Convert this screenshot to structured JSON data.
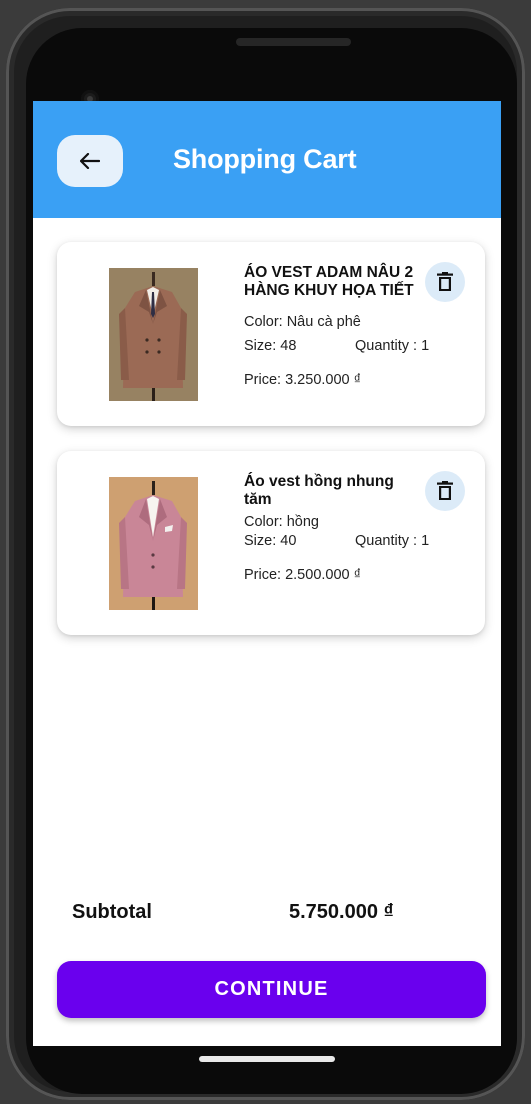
{
  "header": {
    "title": "Shopping Cart",
    "back_icon": "arrow-left-icon"
  },
  "items": [
    {
      "name": "ÁO VEST ADAM NÂU 2 HÀNG KHUY HỌA TIẾT",
      "color_text": "Color: Nâu cà phê",
      "size_text": "Size: 48",
      "quantity_text": "Quantity : 1",
      "price_text": "Price: 3.250.000 ₫",
      "delete_icon": "trash-icon",
      "jacket_color": "#9b6a55"
    },
    {
      "name": "Áo vest hồng nhung tăm",
      "color_text": "Color: hồng",
      "size_text": "Size: 40",
      "quantity_text": "Quantity : 1",
      "price_text": "Price: 2.500.000 ₫",
      "delete_icon": "trash-icon",
      "jacket_color": "#c98697"
    }
  ],
  "subtotal": {
    "label": "Subtotal",
    "value": "5.750.000 ₫"
  },
  "continue_button": {
    "label": "CONTINUE"
  },
  "colors": {
    "appbar": "#3aa0f4",
    "primary_button": "#6a00ee",
    "back_button_bg": "#e6f1fb",
    "delete_button_bg": "#dcebf8"
  }
}
